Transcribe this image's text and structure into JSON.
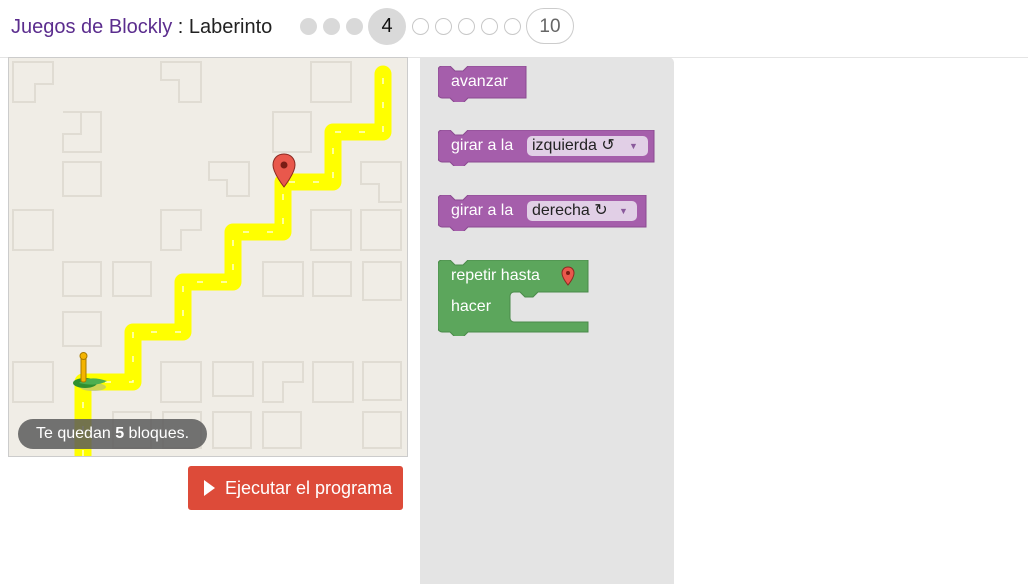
{
  "header": {
    "app_name": "Juegos de Blockly",
    "separator": " : ",
    "game_name": "Laberinto",
    "levels": {
      "completed": [
        1,
        2,
        3
      ],
      "current": "4",
      "upcoming": [
        5,
        6,
        7,
        8,
        9
      ],
      "last": "10"
    }
  },
  "maze": {
    "start_icon": "pegman-icon",
    "goal_icon": "map-marker-icon",
    "path_color": "#ffff00",
    "caption_pre": "Te quedan ",
    "caption_count": "5",
    "caption_post": " bloques."
  },
  "run_button": {
    "label": "Ejecutar el programa",
    "icon": "play-icon",
    "color": "#dd4b39"
  },
  "toolbox": {
    "move_forward": {
      "label": "avanzar",
      "color": "#a55eab"
    },
    "turn_left": {
      "label": "girar a la",
      "option": "izquierda ↺",
      "color": "#a55eab"
    },
    "turn_right": {
      "label": "girar a la",
      "option": "derecha ↻",
      "color": "#a55eab"
    },
    "repeat_until": {
      "label": "repetir hasta",
      "do_label": "hacer",
      "icon": "map-marker-icon",
      "color": "#5ca65c"
    }
  }
}
